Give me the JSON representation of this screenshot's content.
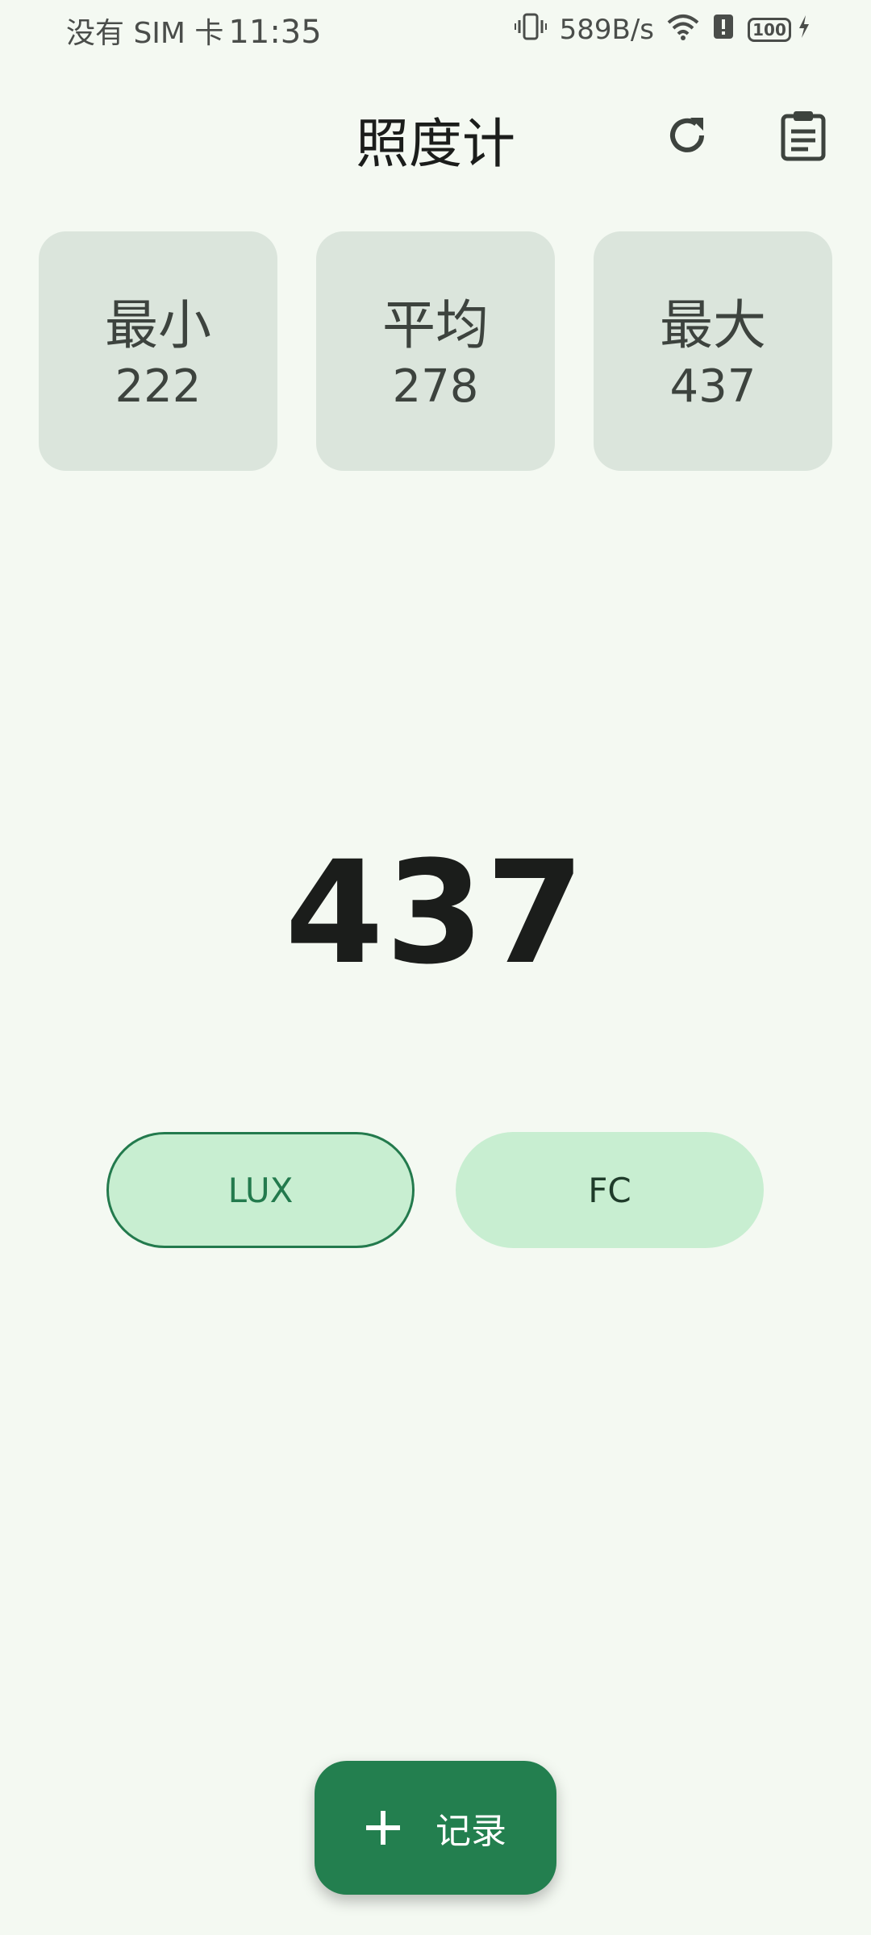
{
  "status_bar": {
    "carrier": "没有 SIM 卡",
    "time": "11:35",
    "net_speed": "589B/s",
    "battery": "100",
    "icons": [
      "vibrate-icon",
      "wifi-icon",
      "alert-icon",
      "battery-icon",
      "charging-icon"
    ]
  },
  "header": {
    "title": "照度计",
    "refresh_icon": "refresh-icon",
    "clipboard_icon": "clipboard-icon"
  },
  "stats": [
    {
      "label": "最小",
      "value": "222"
    },
    {
      "label": "平均",
      "value": "278"
    },
    {
      "label": "最大",
      "value": "437"
    }
  ],
  "reading": {
    "value": "437"
  },
  "units": {
    "lux": "LUX",
    "fc": "FC",
    "selected": "LUX"
  },
  "fab": {
    "label": "记录",
    "icon": "plus-icon"
  },
  "colors": {
    "background": "#f4f9f2",
    "card": "#dbe5dc",
    "accent": "#237f4f",
    "toggle": "#c8eed1"
  }
}
